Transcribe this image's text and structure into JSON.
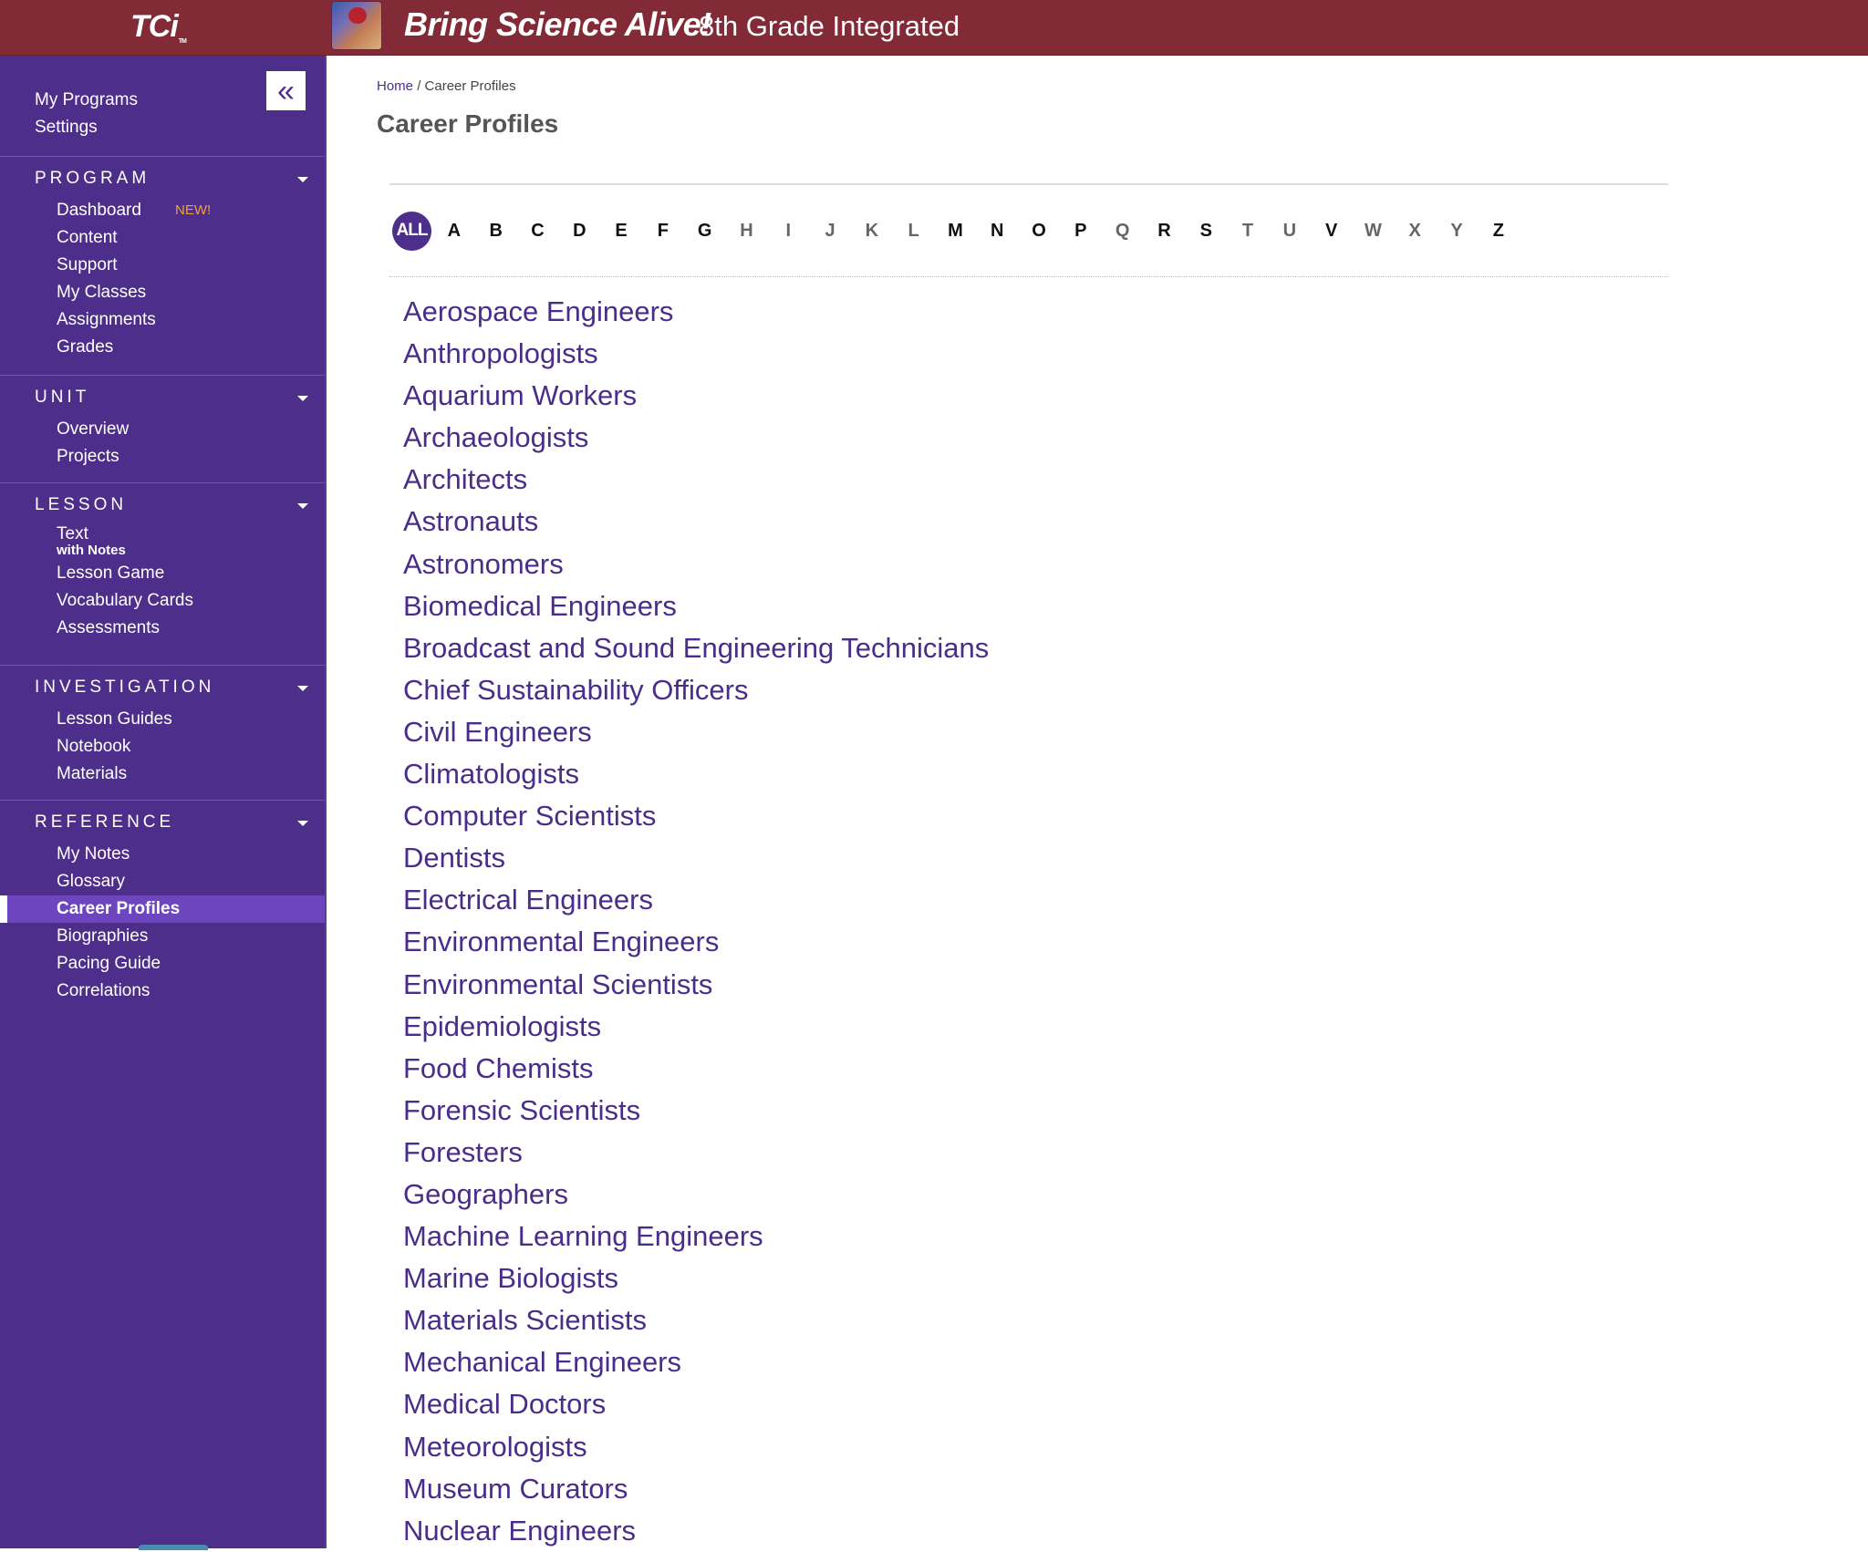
{
  "header": {
    "logo": "TCi",
    "logo_tm": "TM",
    "brand": "Bring Science Alive!",
    "program_title": "8th Grade Integrated",
    "colors": {
      "header_bg": "#822a36",
      "sidebar_bg": "#4d2e8a",
      "accent": "#4d2e8a",
      "badge": "#f0a23a"
    }
  },
  "sidebar": {
    "collapse_icon": "«",
    "top_links": [
      "My Programs",
      "Settings"
    ],
    "sections": [
      {
        "title": "PROGRAM",
        "items": [
          {
            "label": "Dashboard",
            "badge": "NEW!"
          },
          {
            "label": "Content"
          },
          {
            "label": "Support"
          },
          {
            "label": "My Classes"
          },
          {
            "label": "Assignments"
          },
          {
            "label": "Grades"
          }
        ]
      },
      {
        "title": "UNIT",
        "items": [
          {
            "label": "Overview"
          },
          {
            "label": "Projects"
          }
        ]
      },
      {
        "title": "LESSON",
        "items": [
          {
            "label": "Text",
            "sublabel": "with Notes"
          },
          {
            "label": "Lesson Game"
          },
          {
            "label": "Vocabulary Cards"
          },
          {
            "label": "Assessments"
          }
        ]
      },
      {
        "title": "INVESTIGATION",
        "items": [
          {
            "label": "Lesson Guides"
          },
          {
            "label": "Notebook"
          },
          {
            "label": "Materials"
          }
        ]
      },
      {
        "title": "REFERENCE",
        "items": [
          {
            "label": "My Notes"
          },
          {
            "label": "Glossary"
          },
          {
            "label": "Career Profiles",
            "active": true
          },
          {
            "label": "Biographies"
          },
          {
            "label": "Pacing Guide"
          },
          {
            "label": "Correlations"
          }
        ]
      }
    ]
  },
  "main": {
    "breadcrumb": {
      "home": "Home",
      "separator": "/",
      "current": "Career Profiles"
    },
    "title": "Career Profiles",
    "filter": {
      "all_label": "ALL",
      "selected": "ALL",
      "letters": [
        {
          "l": "A",
          "enabled": true
        },
        {
          "l": "B",
          "enabled": true
        },
        {
          "l": "C",
          "enabled": true
        },
        {
          "l": "D",
          "enabled": true
        },
        {
          "l": "E",
          "enabled": true
        },
        {
          "l": "F",
          "enabled": true
        },
        {
          "l": "G",
          "enabled": true
        },
        {
          "l": "H",
          "enabled": false
        },
        {
          "l": "I",
          "enabled": false
        },
        {
          "l": "J",
          "enabled": false
        },
        {
          "l": "K",
          "enabled": false
        },
        {
          "l": "L",
          "enabled": false
        },
        {
          "l": "M",
          "enabled": true
        },
        {
          "l": "N",
          "enabled": true
        },
        {
          "l": "O",
          "enabled": true
        },
        {
          "l": "P",
          "enabled": true
        },
        {
          "l": "Q",
          "enabled": false
        },
        {
          "l": "R",
          "enabled": true
        },
        {
          "l": "S",
          "enabled": true
        },
        {
          "l": "T",
          "enabled": false
        },
        {
          "l": "U",
          "enabled": false
        },
        {
          "l": "V",
          "enabled": true
        },
        {
          "l": "W",
          "enabled": false
        },
        {
          "l": "X",
          "enabled": false
        },
        {
          "l": "Y",
          "enabled": false
        },
        {
          "l": "Z",
          "enabled": true
        }
      ]
    },
    "careers": [
      "Aerospace Engineers",
      "Anthropologists",
      "Aquarium Workers",
      "Archaeologists",
      "Architects",
      "Astronauts",
      "Astronomers",
      "Biomedical Engineers",
      "Broadcast and Sound Engineering Technicians",
      "Chief Sustainability Officers",
      "Civil Engineers",
      "Climatologists",
      "Computer Scientists",
      "Dentists",
      "Electrical Engineers",
      "Environmental Engineers",
      "Environmental Scientists",
      "Epidemiologists",
      "Food Chemists",
      "Forensic Scientists",
      "Foresters",
      "Geographers",
      "Machine Learning Engineers",
      "Marine Biologists",
      "Materials Scientists",
      "Mechanical Engineers",
      "Medical Doctors",
      "Meteorologists",
      "Museum Curators",
      "Nuclear Engineers"
    ]
  }
}
